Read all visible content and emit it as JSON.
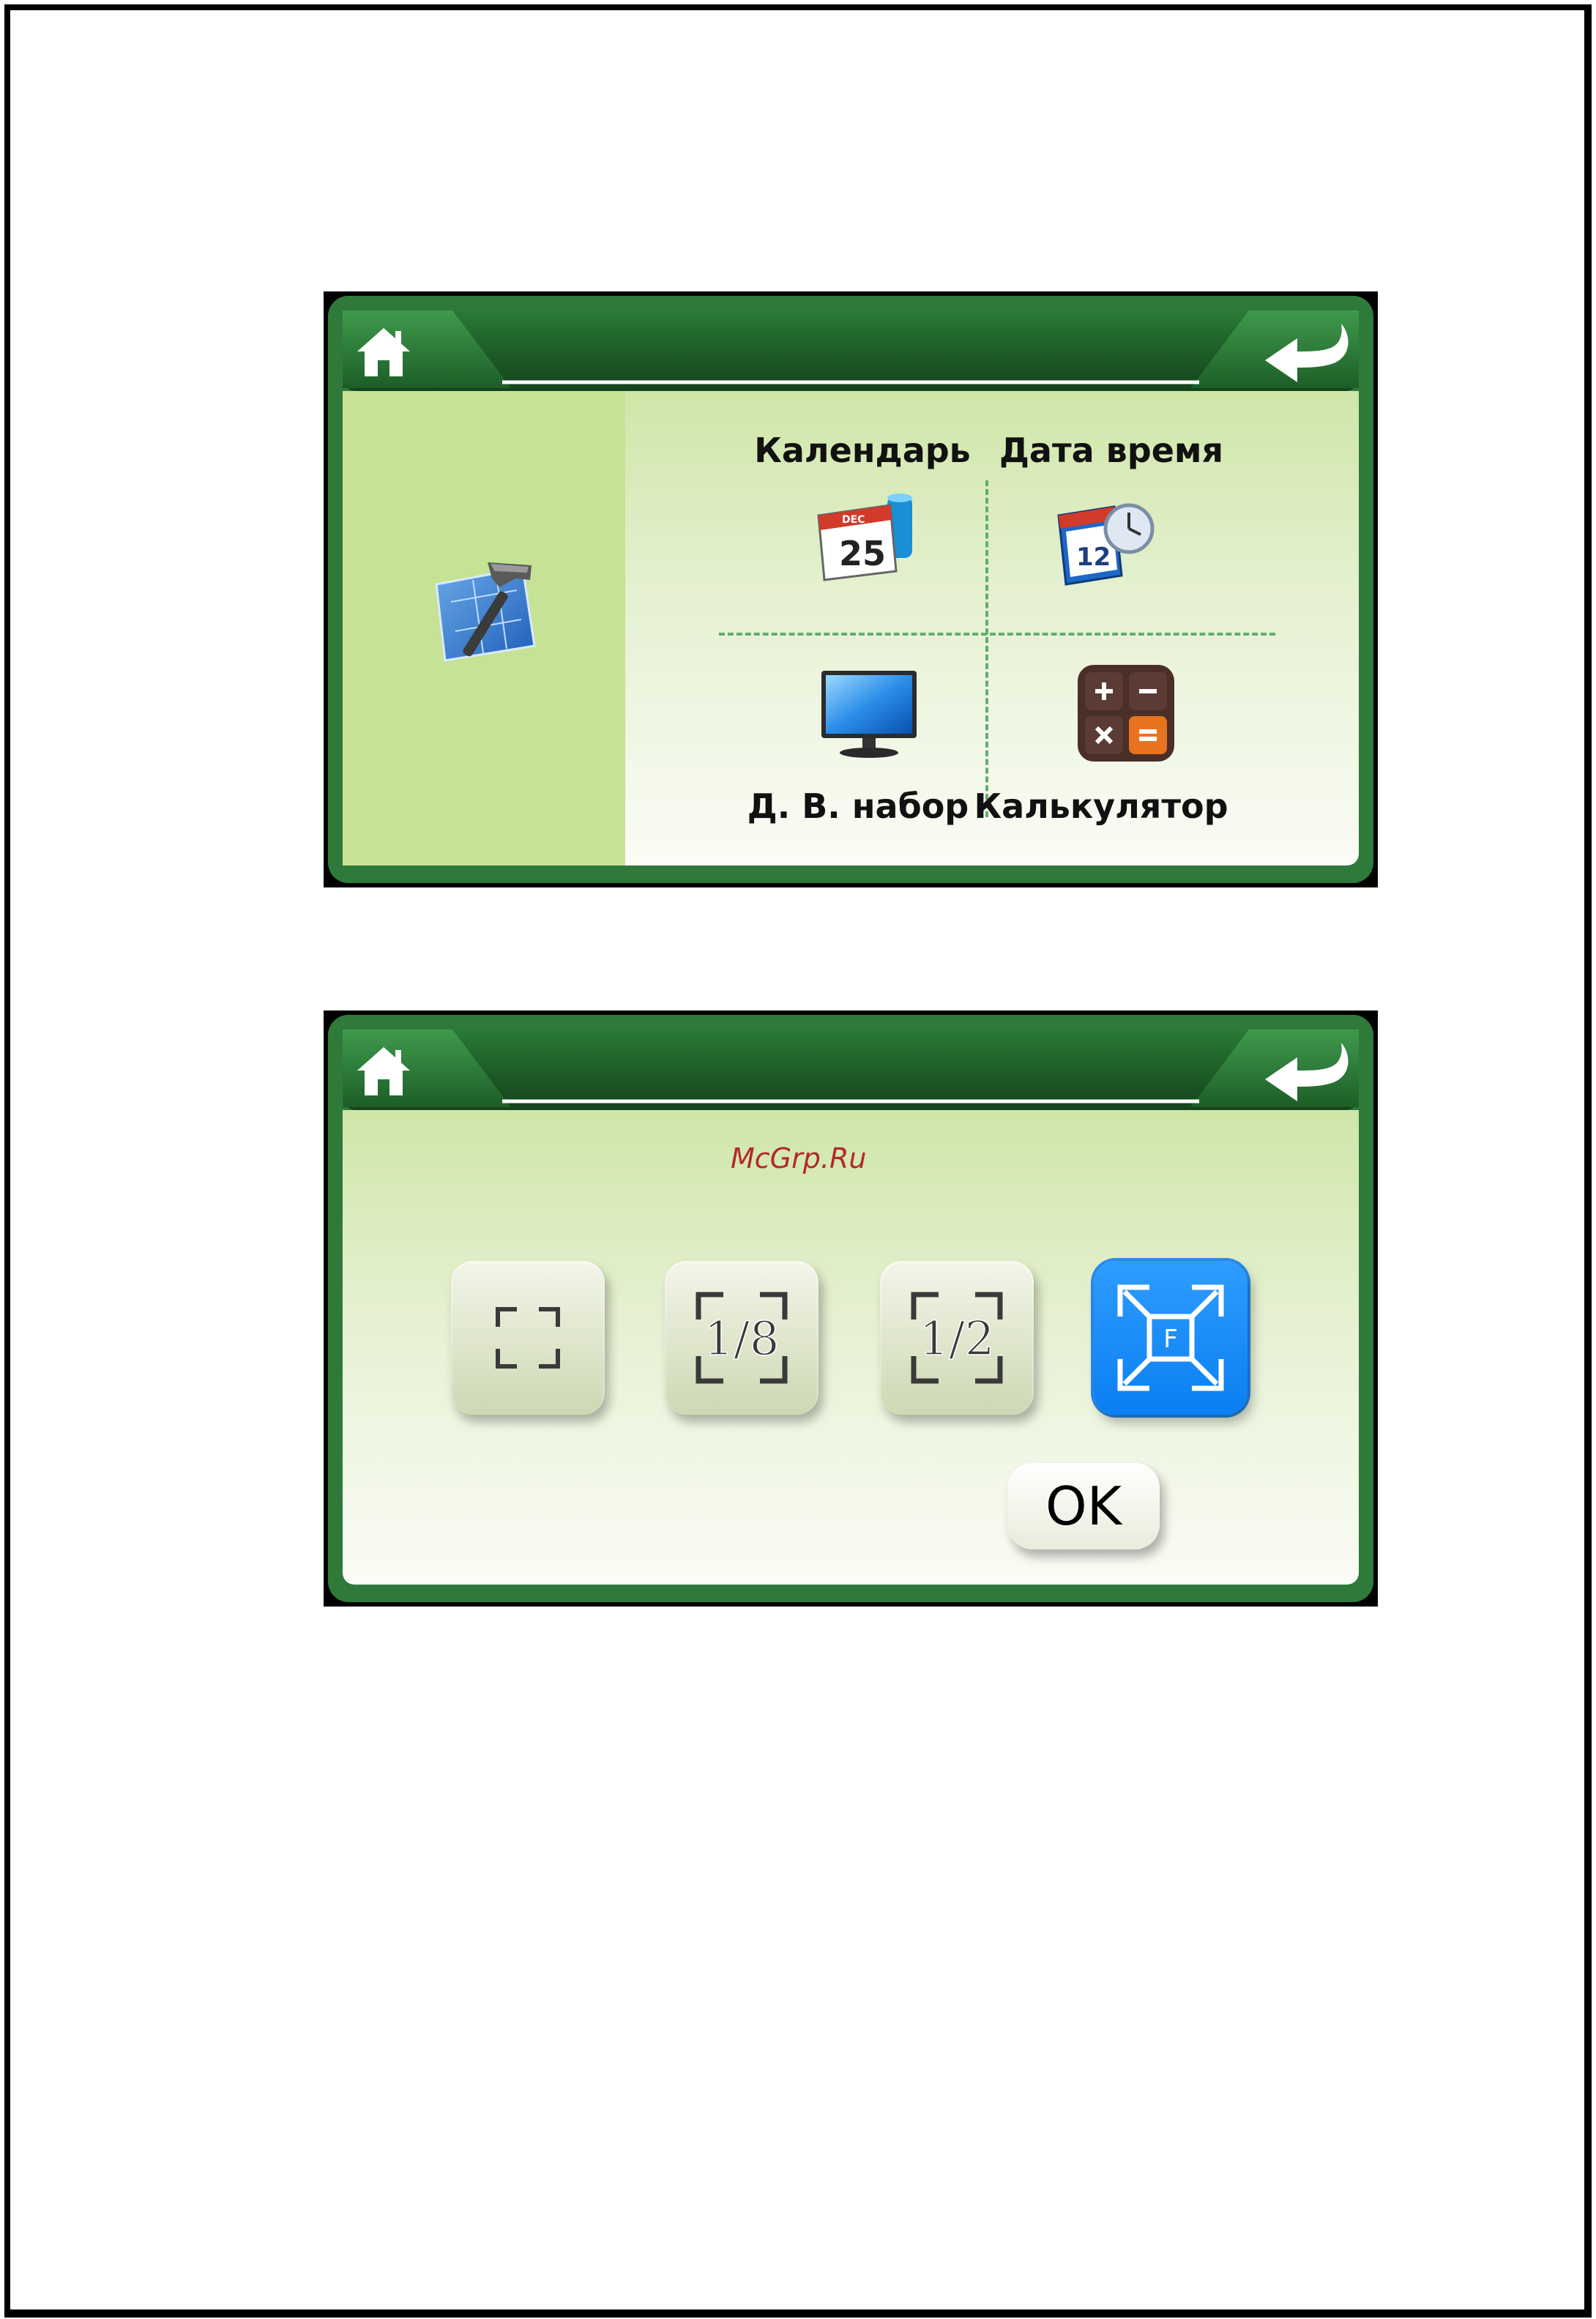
{
  "screen1": {
    "menu": [
      {
        "label": "Календарь",
        "icon": "calendar-icon"
      },
      {
        "label": "Дата время",
        "icon": "datetime-clock-icon"
      },
      {
        "label": "Д. В. набор",
        "icon": "monitor-icon"
      },
      {
        "label": "Калькулятор",
        "icon": "calculator-icon"
      }
    ],
    "calendar_day": "25",
    "clock_number": "12",
    "calendar_month": "DEC"
  },
  "screen2": {
    "watermark": "McGrp.Ru",
    "ratio_options": [
      {
        "label": "",
        "icon": "fit-icon",
        "selected": false
      },
      {
        "label": "1/8",
        "icon": "ratio-1-8-icon",
        "selected": false
      },
      {
        "label": "1/2",
        "icon": "ratio-1-2-icon",
        "selected": false
      },
      {
        "label": "F",
        "icon": "fullscreen-icon",
        "selected": true
      }
    ],
    "ok_label": "OK"
  },
  "colors": {
    "frame_green": "#2f7a3a",
    "panel_green": "#c6e294",
    "accent_blue": "#0a7ff2"
  }
}
